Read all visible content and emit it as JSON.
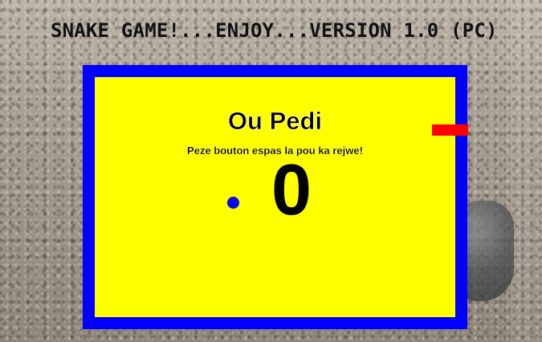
{
  "header": {
    "title": "SNAKE GAME!...ENJOY...VERSION 1.0 (PC)"
  },
  "game": {
    "status_title": "Ou Pedi",
    "instruction": "Peze bouton espas la pou ka rejwe!",
    "score": "0",
    "colors": {
      "board_border": "#0000ff",
      "board_fill": "#ffff00",
      "snake": "#ff0000",
      "food": "#0a0ae6"
    }
  },
  "icons": {
    "snake": "snake-segment",
    "food": "food-dot",
    "background": "sand-photo"
  }
}
